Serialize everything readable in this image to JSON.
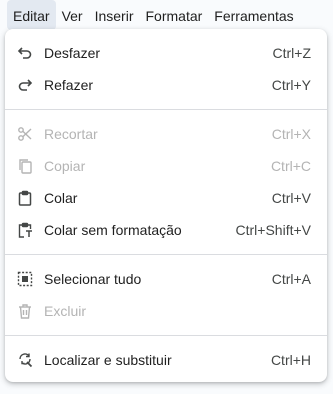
{
  "menubar": {
    "items": [
      {
        "label": "Editar"
      },
      {
        "label": "Ver"
      },
      {
        "label": "Inserir"
      },
      {
        "label": "Formatar"
      },
      {
        "label": "Ferramentas"
      }
    ]
  },
  "edit_menu": {
    "undo": {
      "label": "Desfazer",
      "shortcut": "Ctrl+Z",
      "icon": "undo-icon"
    },
    "redo": {
      "label": "Refazer",
      "shortcut": "Ctrl+Y",
      "icon": "redo-icon"
    },
    "cut": {
      "label": "Recortar",
      "shortcut": "Ctrl+X",
      "icon": "scissors-icon",
      "disabled": true
    },
    "copy": {
      "label": "Copiar",
      "shortcut": "Ctrl+C",
      "icon": "copy-icon",
      "disabled": true
    },
    "paste": {
      "label": "Colar",
      "shortcut": "Ctrl+V",
      "icon": "clipboard-icon"
    },
    "paste_plain": {
      "label": "Colar sem formatação",
      "shortcut": "Ctrl+Shift+V",
      "icon": "clipboard-plain-icon"
    },
    "select_all": {
      "label": "Selecionar tudo",
      "shortcut": "Ctrl+A",
      "icon": "select-all-icon"
    },
    "delete": {
      "label": "Excluir",
      "shortcut": "",
      "icon": "trash-icon",
      "disabled": true
    },
    "find_replace": {
      "label": "Localizar e substituir",
      "shortcut": "Ctrl+H",
      "icon": "find-replace-icon"
    }
  },
  "colors": {
    "text": "#1f1f1f",
    "disabled": "#b4b4b4",
    "active_menu_bg": "#e3e9f1"
  }
}
